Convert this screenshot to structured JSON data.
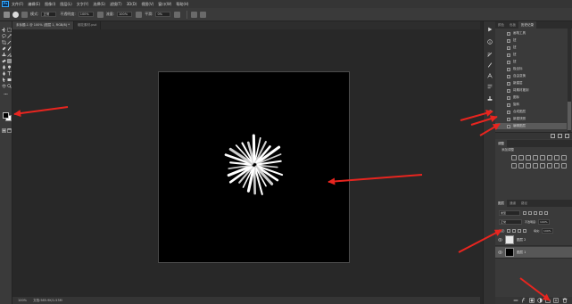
{
  "app": {
    "logo_text": "Ps"
  },
  "menu": [
    "文件(F)",
    "编辑(E)",
    "图像(I)",
    "图层(L)",
    "文字(Y)",
    "选择(S)",
    "滤镜(T)",
    "3D(D)",
    "视图(V)",
    "窗口(W)",
    "帮助(H)"
  ],
  "options": {
    "mode_label": "模式:",
    "mode_value": "正常",
    "opacity_label": "不透明度:",
    "opacity_value": "100%",
    "flow_label": "流量:",
    "flow_value": "100%",
    "smoothing_label": "平滑:",
    "smoothing_value": "0%",
    "icon_brush": "brush-tool-icon",
    "icon_preset": "brush-preset-icon",
    "icon_airbrush": "airbrush-icon",
    "icon_gear": "gear-icon",
    "icon_symmetry": "symmetry-icon",
    "icon_settings": "brush-settings-icon"
  },
  "tabs": [
    {
      "label": "未标题-1 @ 100% (图层 1, RGB/8) *",
      "active": true
    },
    {
      "label": "烟花素材.psd",
      "active": false
    }
  ],
  "history": {
    "tabs": [
      "颜色",
      "色板",
      "历史记录"
    ],
    "active_tab": 2,
    "items": [
      {
        "label": "画笔工具",
        "icon": "brush-icon"
      },
      {
        "label": "扭",
        "icon": "brush-icon"
      },
      {
        "label": "扭",
        "icon": "brush-icon"
      },
      {
        "label": "扭",
        "icon": "brush-icon"
      },
      {
        "label": "扭",
        "icon": "brush-icon"
      },
      {
        "label": "极坐标",
        "icon": "filter-icon"
      },
      {
        "label": "自由变换",
        "icon": "transform-icon"
      },
      {
        "label": "新建层",
        "icon": "layer-icon"
      },
      {
        "label": "将素材搬到",
        "icon": "layer-icon"
      },
      {
        "label": "图标",
        "icon": "brush-icon"
      },
      {
        "label": "旋转",
        "icon": "transform-icon"
      },
      {
        "label": "合成图层",
        "icon": "layer-icon"
      },
      {
        "label": "新建快照",
        "icon": "snapshot-icon"
      },
      {
        "label": "编辑图层",
        "icon": "layer-icon"
      }
    ],
    "active_index": 13
  },
  "adjustments": {
    "tabs": [
      "调整"
    ],
    "label": "添加调整",
    "icons": [
      "brightness-icon",
      "curves-icon",
      "levels-icon",
      "exposure-icon",
      "vibrance-icon",
      "hue-saturation-icon",
      "color-balance-icon",
      "black-white-icon",
      "photo-filter-icon",
      "channel-mixer-icon",
      "color-lookup-icon",
      "invert-icon",
      "posterize-icon",
      "threshold-icon",
      "selective-color-icon",
      "gradient-map-icon"
    ]
  },
  "layers": {
    "tabs": [
      "图层",
      "通道",
      "路径"
    ],
    "active_tab": 0,
    "kind": "类型",
    "blend_mode": "正常",
    "opacity_label": "不透明度:",
    "opacity_value": "100%",
    "lock_label": "锁定:",
    "fill_label": "填充:",
    "fill_value": "100%",
    "items": [
      {
        "name": "图层 2",
        "thumb": "#e9e9e9",
        "selected": false
      },
      {
        "name": "图层 1",
        "thumb": "#000000",
        "selected": true
      }
    ],
    "footer_icons": [
      "link-icon",
      "fx-icon",
      "mask-icon",
      "adjustment-layer-icon",
      "group-icon",
      "new-layer-icon",
      "trash-icon"
    ]
  },
  "status": {
    "zoom": "100%",
    "doc": "文档:585.9K/1.53M"
  },
  "colors": {
    "foreground": "#000000",
    "background": "#ffffff",
    "accent": "#31a8ff",
    "arrow": "#e8251f"
  }
}
